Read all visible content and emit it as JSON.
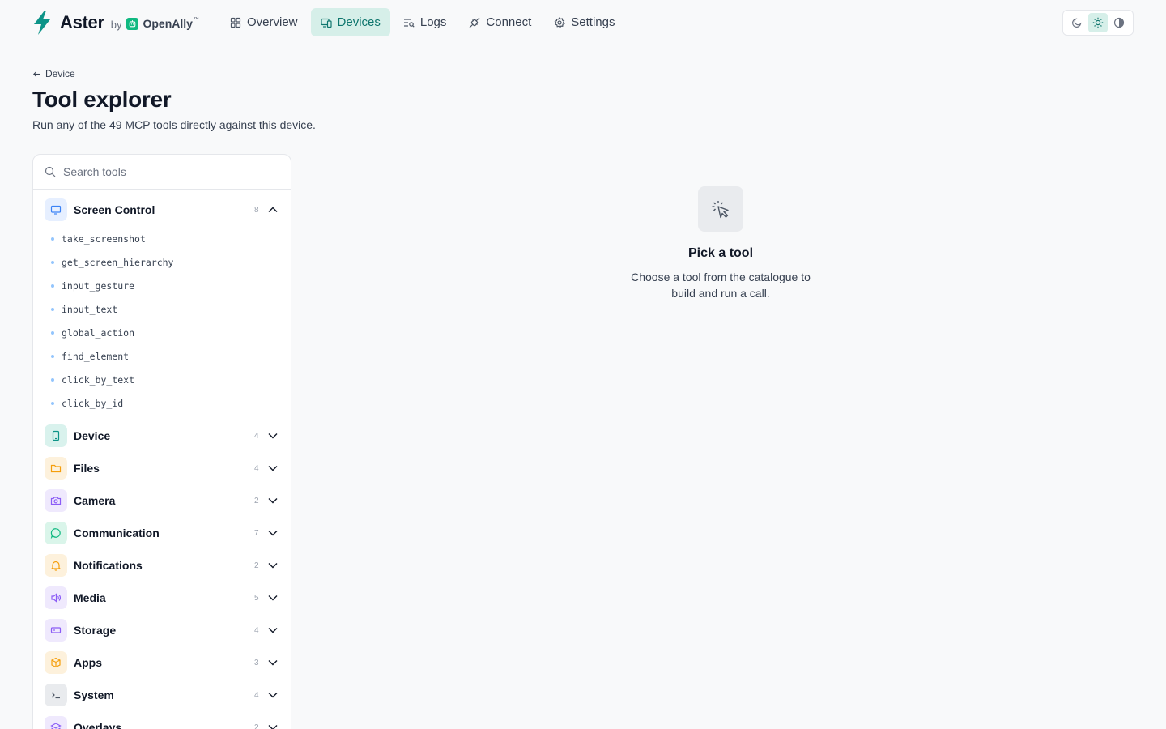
{
  "brand": {
    "name": "Aster",
    "by": "by",
    "partner": "OpenAlly",
    "tm": "™"
  },
  "nav": [
    {
      "label": "Overview",
      "icon": "grid-icon",
      "active": false
    },
    {
      "label": "Devices",
      "icon": "devices-icon",
      "active": true
    },
    {
      "label": "Logs",
      "icon": "logs-icon",
      "active": false
    },
    {
      "label": "Connect",
      "icon": "plug-icon",
      "active": false
    },
    {
      "label": "Settings",
      "icon": "gear-icon",
      "active": false
    }
  ],
  "theme": {
    "options": [
      "moon-icon",
      "sun-icon",
      "contrast-icon"
    ],
    "active": "sun-icon"
  },
  "page": {
    "back_label": "Device",
    "title": "Tool explorer",
    "subtitle": "Run any of the 49 MCP tools directly against this device."
  },
  "search": {
    "placeholder": "Search tools",
    "value": ""
  },
  "categories": [
    {
      "label": "Screen Control",
      "count": "8",
      "expanded": true,
      "icon": "monitor-icon",
      "color": "#3b82f6",
      "bg": "#e6efff",
      "tools": [
        "take_screenshot",
        "get_screen_hierarchy",
        "input_gesture",
        "input_text",
        "global_action",
        "find_element",
        "click_by_text",
        "click_by_id"
      ]
    },
    {
      "label": "Device",
      "count": "4",
      "expanded": false,
      "icon": "phone-icon",
      "color": "#0d9488",
      "bg": "#d9f2ed"
    },
    {
      "label": "Files",
      "count": "4",
      "expanded": false,
      "icon": "folder-icon",
      "color": "#f59e0b",
      "bg": "#fdf1dc"
    },
    {
      "label": "Camera",
      "count": "2",
      "expanded": false,
      "icon": "camera-icon",
      "color": "#8b5cf6",
      "bg": "#efe9fd"
    },
    {
      "label": "Communication",
      "count": "7",
      "expanded": false,
      "icon": "chat-icon",
      "color": "#10b981",
      "bg": "#daf5ea"
    },
    {
      "label": "Notifications",
      "count": "2",
      "expanded": false,
      "icon": "bell-icon",
      "color": "#f59e0b",
      "bg": "#fdf1dc"
    },
    {
      "label": "Media",
      "count": "5",
      "expanded": false,
      "icon": "speaker-icon",
      "color": "#8b5cf6",
      "bg": "#efe9fd"
    },
    {
      "label": "Storage",
      "count": "4",
      "expanded": false,
      "icon": "storage-icon",
      "color": "#8b5cf6",
      "bg": "#efe9fd"
    },
    {
      "label": "Apps",
      "count": "3",
      "expanded": false,
      "icon": "package-icon",
      "color": "#f59e0b",
      "bg": "#fdf1dc"
    },
    {
      "label": "System",
      "count": "4",
      "expanded": false,
      "icon": "terminal-icon",
      "color": "#4b5563",
      "bg": "#e9ebee"
    },
    {
      "label": "Overlays",
      "count": "2",
      "expanded": false,
      "icon": "layers-icon",
      "color": "#8b5cf6",
      "bg": "#efe9fd"
    }
  ],
  "empty": {
    "icon": "cursor-click-icon",
    "title": "Pick a tool",
    "description": "Choose a tool from the catalogue to build and run a call."
  }
}
